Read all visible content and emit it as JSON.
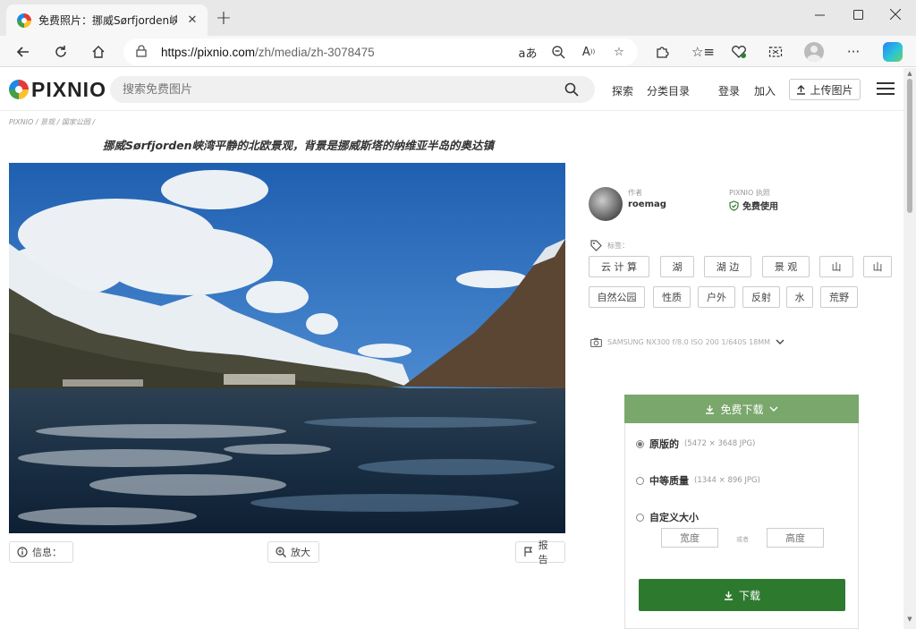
{
  "browser": {
    "tab_title": "免费照片：挪威Sørfjorden峡湾平",
    "url_host": "https://pixnio.com",
    "url_path": "/zh/media/zh-3078475"
  },
  "site": {
    "logo_text": "PIXNIO",
    "search_placeholder": "搜索免费图片",
    "nav": {
      "explore": "探索",
      "categories": "分类目录",
      "login": "登录",
      "join": "加入",
      "upload": "上传图片"
    }
  },
  "breadcrumb": "PIXNIO / 景观 / 国家公园 /",
  "title": "挪威Sørfjorden峡湾平静的北欧景观，背景是挪威斯塔的纳维亚半岛的奥达镇",
  "photo_actions": {
    "info": "信息：",
    "zoom": "放大",
    "report": "报告"
  },
  "author": {
    "label": "作者",
    "name": "roemag"
  },
  "license": {
    "label": "PIXNIO 执照",
    "value": "免费使用"
  },
  "tags": {
    "label": "标签：",
    "items": [
      "云 计 算",
      "湖",
      "湖 边",
      "景 观",
      "山",
      "山",
      "自然公园",
      "性质",
      "户外",
      "反射",
      "水",
      "荒野"
    ]
  },
  "exif": "SAMSUNG NX300  f/8.0  ISO   200  1/640S  18MM",
  "download": {
    "button": "免费下载",
    "options": [
      {
        "name": "原版的",
        "meta": "(5472 × 3648  JPG)",
        "selected": true
      },
      {
        "name": "中等质量",
        "meta": "(1344 × 896  JPG)",
        "selected": false
      },
      {
        "name": "自定义大小",
        "meta": "",
        "selected": false
      }
    ],
    "width_placeholder": "宽度",
    "or": "或者",
    "height_placeholder": "高度",
    "submit": "下载"
  },
  "colors": {
    "download_header": "#7aa76c",
    "download_submit": "#2d7a2f"
  }
}
